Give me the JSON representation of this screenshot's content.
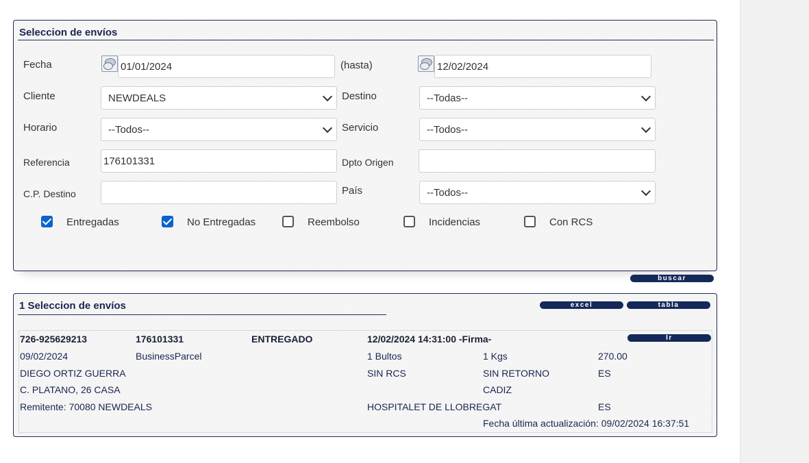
{
  "search_panel": {
    "title": "Seleccion de envíos",
    "fecha_label": "Fecha",
    "fecha_from": "01/01/2024",
    "hasta_label": "(hasta)",
    "fecha_to": "12/02/2024",
    "cliente_label": "Cliente",
    "cliente_value": "NEWDEALS",
    "destino_label": "Destino",
    "destino_value": "--Todas--",
    "horario_label": "Horario",
    "horario_value": "--Todos--",
    "servicio_label": "Servicio",
    "servicio_value": "--Todos--",
    "referencia_label": "Referencia",
    "referencia_value": "176101331",
    "dpto_label": "Dpto Origen",
    "dpto_value": "",
    "cp_label": "C.P. Destino",
    "cp_value": "",
    "pais_label": "País",
    "pais_value": "--Todos--",
    "checkboxes": [
      {
        "label": "Entregadas",
        "checked": true
      },
      {
        "label": "No Entregadas",
        "checked": true
      },
      {
        "label": "Reembolso",
        "checked": false
      },
      {
        "label": "Incidencias",
        "checked": false
      },
      {
        "label": "Con RCS",
        "checked": false
      }
    ],
    "buscar_label": "buscar"
  },
  "results_panel": {
    "title": "1 Seleccion de envíos",
    "excel_label": "excel",
    "tabla_label": "tabla",
    "ir_label": "Ir",
    "row": {
      "expedicion": "726-925629213",
      "referencia": "176101331",
      "estado": "ENTREGADO",
      "fecha_entrega": "12/02/2024 14:31:00 -Firma-",
      "fecha": "09/02/2024",
      "servicio": "BusinessParcel",
      "bultos": "1 Bultos",
      "kgs": "1 Kgs",
      "importe": "270.00",
      "destinatario": "DIEGO ORTIZ GUERRA",
      "rcs": "SIN RCS",
      "retorno": "SIN RETORNO",
      "pais_dest": "ES",
      "direccion": "C. PLATANO, 26 CASA",
      "provincia": "CADIZ",
      "remitente": "Remitente: 70080 NEWDEALS",
      "poblacion_origen": "HOSPITALET DE LLOBREGAT",
      "pais_origen": "ES",
      "ultima_actualizacion": "Fecha última actualización: 09/02/2024 16:37:51"
    }
  }
}
